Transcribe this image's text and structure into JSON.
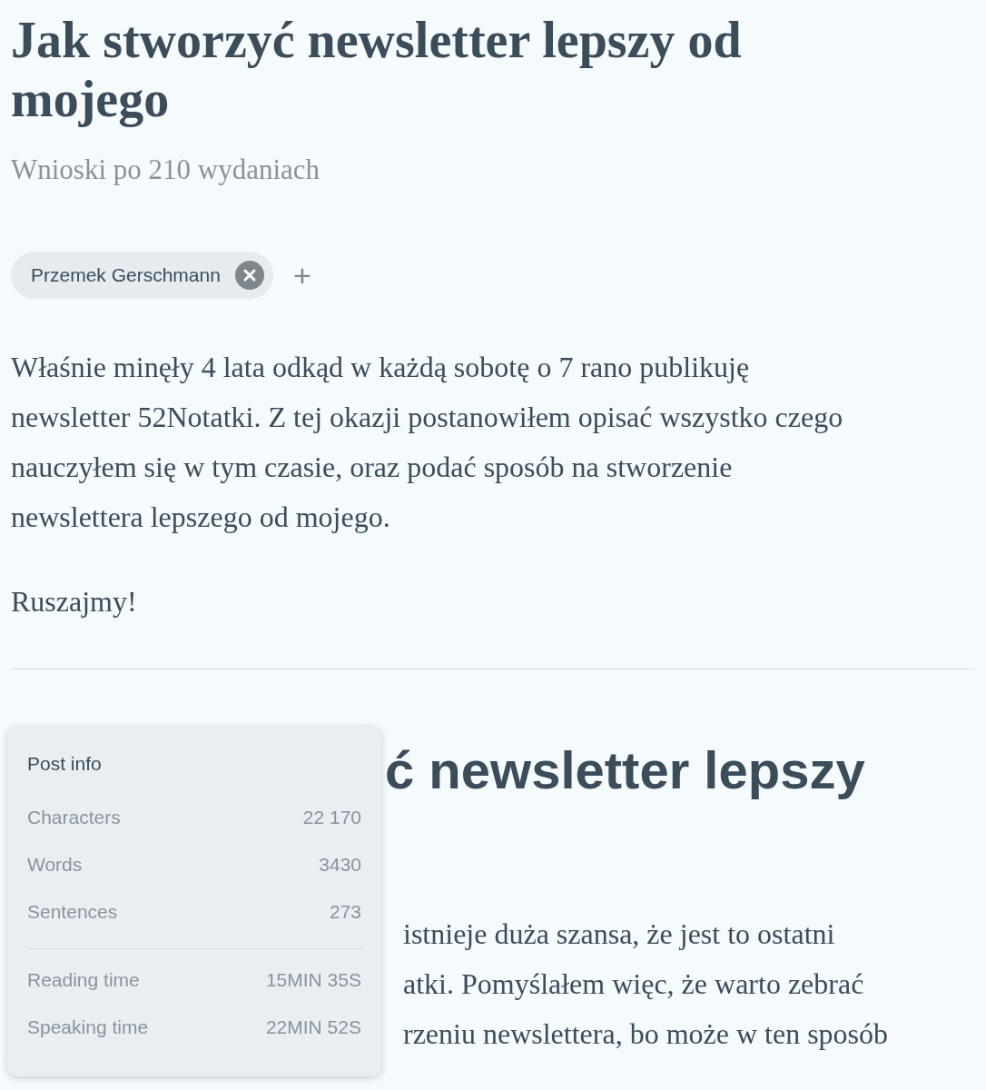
{
  "article": {
    "title": "Jak stworzyć newsletter lepszy od mojego",
    "subtitle": "Wnioski po 210 wydaniach",
    "authors": [
      {
        "name": "Przemek Gerschmann"
      }
    ],
    "add_author": "+",
    "paragraphs": [
      "Właśnie minęły 4 lata odkąd w każdą sobotę o 7 rano publikuję newsletter 52Notatki. Z tej okazji postanowiłem opisać wszystko czego nauczyłem się w tym czasie, oraz podać sposób na stworzenie newslettera lepszego od mojego.",
      "Ruszajmy!"
    ]
  },
  "preview": {
    "heading": "ć newsletter lepszy",
    "lines": [
      "istnieje duża szansa, że jest to ostatni",
      "atki. Pomyślałem więc, że warto zebrać",
      "rzeniu newslettera, bo może w ten sposób"
    ]
  },
  "post_info": {
    "title": "Post info",
    "counts": [
      {
        "label": "Characters",
        "value": "22 170"
      },
      {
        "label": "Words",
        "value": "3430"
      },
      {
        "label": "Sentences",
        "value": "273"
      }
    ],
    "times": [
      {
        "label": "Reading time",
        "value": "15MIN 35S"
      },
      {
        "label": "Speaking time",
        "value": "22MIN 52S"
      }
    ]
  }
}
